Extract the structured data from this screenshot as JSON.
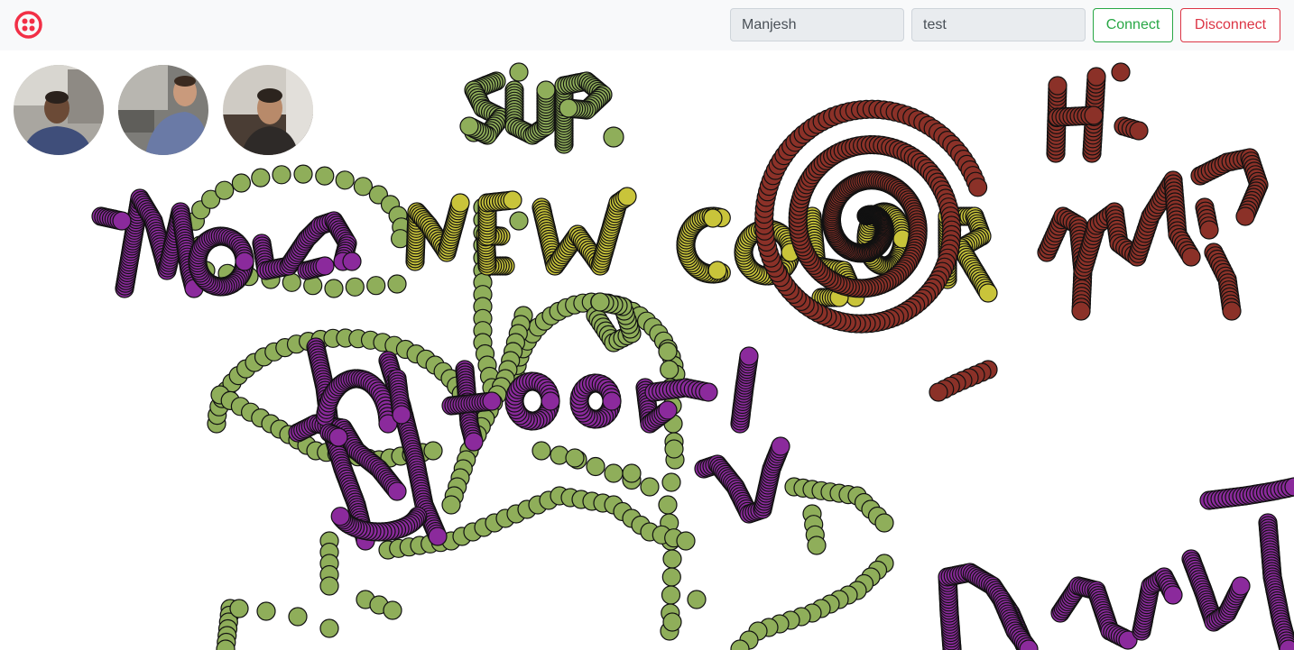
{
  "header": {
    "logo_icon": "twilio-logo-icon",
    "brand_color": "#f22f46",
    "name_field": {
      "value": "Manjesh"
    },
    "room_field": {
      "value": "test"
    },
    "connect_label": "Connect",
    "disconnect_label": "Disconnect",
    "connect_color": "#28a745",
    "disconnect_color": "#dc3545"
  },
  "participants": [
    {
      "avatar_icon": "participant-video-1"
    },
    {
      "avatar_icon": "participant-video-2"
    },
    {
      "avatar_icon": "participant-video-3"
    }
  ],
  "drawing": {
    "colors": {
      "green": "#8fae5a",
      "yellow": "#c9c43a",
      "purple": "#8b2a9c",
      "brown": "#8b3128"
    }
  }
}
